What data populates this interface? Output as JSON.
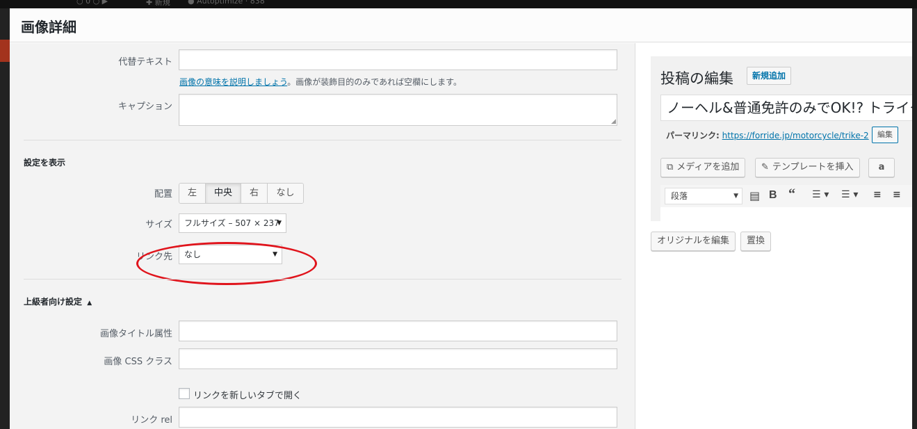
{
  "modal": {
    "title": "画像詳細"
  },
  "fields": {
    "alt_label": "代替テキスト",
    "alt_value": "",
    "alt_help_link": "画像の意味を説明しましょう",
    "alt_help_text": "。画像が装飾目的のみであれば空欄にします。",
    "caption_label": "キャプション",
    "caption_value": ""
  },
  "display": {
    "heading": "設定を表示",
    "align_label": "配置",
    "align_options": [
      "左",
      "中央",
      "右",
      "なし"
    ],
    "align_selected": "中央",
    "size_label": "サイズ",
    "size_value": "フルサイズ – 507 × 237",
    "link_label": "リンク先",
    "link_value": "なし"
  },
  "advanced": {
    "heading": "上級者向け設定",
    "toggle_icon": "triangle-up-icon",
    "title_attr_label": "画像タイトル属性",
    "title_attr_value": "",
    "css_class_label": "画像 CSS クラス",
    "css_class_value": "",
    "new_tab_label": "リンクを新しいタブで開く",
    "new_tab_checked": false,
    "link_rel_label": "リンク rel",
    "link_rel_value": ""
  },
  "editor": {
    "title": "投稿の編集",
    "add_new": "新規追加",
    "post_title": "ノーヘル&普通免許のみでOK!? トライク",
    "permalink_label": "パーマリンク:",
    "permalink_url": "https://forride.jp/motorcycle/trike-2",
    "permalink_edit": "編集",
    "add_media": "メディアを追加",
    "insert_template": "テンプレートを挿入",
    "amazon_icon": "amazon-icon",
    "format_select": "段落",
    "toolbar_icons": [
      "clipboard-icon",
      "bold-icon",
      "blockquote-icon",
      "bullet-list-icon",
      "numbered-list-icon",
      "align-left-icon",
      "align-center-icon"
    ]
  },
  "image_actions": {
    "edit_original": "オリジナルを編集",
    "replace": "置換"
  },
  "highlight": {
    "color": "#e0141c",
    "target": "size-select"
  }
}
